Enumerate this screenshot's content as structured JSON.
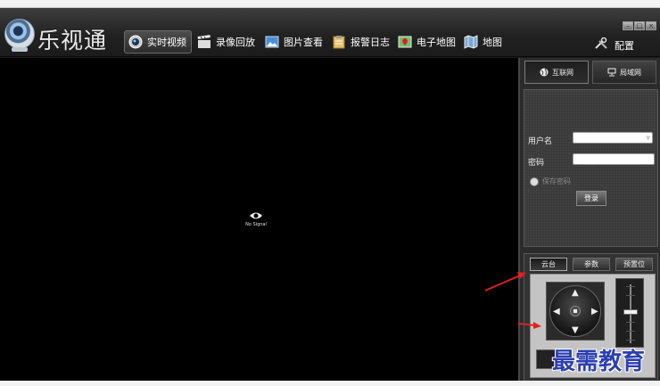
{
  "app": {
    "brand": "乐视通"
  },
  "nav": [
    {
      "label": "实时视频",
      "icon": "camera-icon",
      "active": true
    },
    {
      "label": "录像回放",
      "icon": "clapperboard-icon"
    },
    {
      "label": "图片查看",
      "icon": "picture-icon"
    },
    {
      "label": "报警日志",
      "icon": "clipboard-icon"
    },
    {
      "label": "电子地图",
      "icon": "map-pin-icon"
    },
    {
      "label": "地图",
      "icon": "map-icon"
    }
  ],
  "config": {
    "label": "配置",
    "icon": "wrench-icon"
  },
  "window_controls": [
    "minimize",
    "maximize",
    "close"
  ],
  "video": {
    "status": "No Signal",
    "icon": "eye-icon"
  },
  "network_tabs": [
    {
      "label": "互联网",
      "icon": "globe-icon",
      "active": true
    },
    {
      "label": "局域网",
      "icon": "lan-icon"
    }
  ],
  "login": {
    "username_label": "用户名",
    "username_value": "",
    "password_label": "密码",
    "password_value": "",
    "remember_label": "保存密码",
    "remember_checked": false,
    "login_button": "登录"
  },
  "ptz_tabs": [
    {
      "label": "云台",
      "active": true
    },
    {
      "label": "参数"
    },
    {
      "label": "预置位"
    }
  ],
  "watermark": "最需教育",
  "colors": {
    "accent_red": "#e02020",
    "watermark_blue": "#2c3fb0"
  }
}
